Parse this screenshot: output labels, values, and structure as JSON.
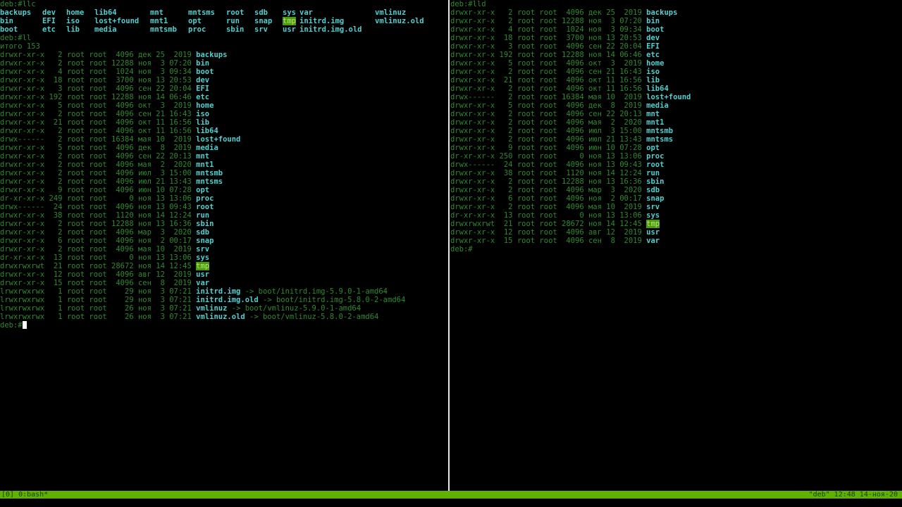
{
  "statusbar": {
    "left": "[0] 0:bash*",
    "right": "\"deb\" 12:48 14-ноя-20"
  },
  "left_pane": {
    "prompt1": "deb:#llc",
    "ls_cols": [
      [
        "backups",
        "bin",
        "boot"
      ],
      [
        "dev",
        "EFI",
        "etc"
      ],
      [
        "home",
        "iso",
        "lib"
      ],
      [
        "lib64",
        "lost+found",
        "media"
      ],
      [
        "mnt",
        "mnt1",
        "mntsmb"
      ],
      [
        "mntsms",
        "opt",
        "proc"
      ],
      [
        "root",
        "run",
        "sbin"
      ],
      [
        "sdb",
        "snap",
        "srv"
      ],
      [
        "sys",
        "tmp",
        "usr"
      ],
      [
        "var",
        "initrd.img",
        "initrd.img.old"
      ],
      [
        "vmlinuz",
        "vmlinuz.old",
        ""
      ]
    ],
    "prompt2": "deb:#ll",
    "total": "итого 153",
    "entries": [
      {
        "meta": "drwxr-xr-x   2 root root  4096 дек 25  2019",
        "name": "backups"
      },
      {
        "meta": "drwxr-xr-x   2 root root 12288 ноя  3 07:20",
        "name": "bin"
      },
      {
        "meta": "drwxr-xr-x   4 root root  1024 ноя  3 09:34",
        "name": "boot"
      },
      {
        "meta": "drwxr-xr-x  18 root root  3700 ноя 13 20:53",
        "name": "dev"
      },
      {
        "meta": "drwxr-xr-x   3 root root  4096 сен 22 20:04",
        "name": "EFI"
      },
      {
        "meta": "drwxr-xr-x 192 root root 12288 ноя 14 06:46",
        "name": "etc"
      },
      {
        "meta": "drwxr-xr-x   5 root root  4096 окт  3  2019",
        "name": "home"
      },
      {
        "meta": "drwxr-xr-x   2 root root  4096 сен 21 16:43",
        "name": "iso"
      },
      {
        "meta": "drwxr-xr-x  21 root root  4096 окт 11 16:56",
        "name": "lib"
      },
      {
        "meta": "drwxr-xr-x   2 root root  4096 окт 11 16:56",
        "name": "lib64"
      },
      {
        "meta": "drwx------   2 root root 16384 мая 10  2019",
        "name": "lost+found"
      },
      {
        "meta": "drwxr-xr-x   5 root root  4096 дек  8  2019",
        "name": "media"
      },
      {
        "meta": "drwxr-xr-x   2 root root  4096 сен 22 20:13",
        "name": "mnt"
      },
      {
        "meta": "drwxr-xr-x   2 root root  4096 мая  2  2020",
        "name": "mnt1"
      },
      {
        "meta": "drwxr-xr-x   2 root root  4096 июл  3 15:00",
        "name": "mntsmb"
      },
      {
        "meta": "drwxr-xr-x   2 root root  4096 июл 21 13:43",
        "name": "mntsms"
      },
      {
        "meta": "drwxr-xr-x   9 root root  4096 июн 10 07:28",
        "name": "opt"
      },
      {
        "meta": "dr-xr-xr-x 249 root root     0 ноя 13 13:06",
        "name": "proc"
      },
      {
        "meta": "drwx------  24 root root  4096 ноя 13 09:43",
        "name": "root"
      },
      {
        "meta": "drwxr-xr-x  38 root root  1120 ноя 14 12:24",
        "name": "run"
      },
      {
        "meta": "drwxr-xr-x   2 root root 12288 ноя 13 16:36",
        "name": "sbin"
      },
      {
        "meta": "drwxr-xr-x   2 root root  4096 мар  3  2020",
        "name": "sdb"
      },
      {
        "meta": "drwxr-xr-x   6 root root  4096 ноя  2 00:17",
        "name": "snap"
      },
      {
        "meta": "drwxr-xr-x   2 root root  4096 мая 10  2019",
        "name": "srv"
      },
      {
        "meta": "dr-xr-xr-x  13 root root     0 ноя 13 13:06",
        "name": "sys"
      },
      {
        "meta": "drwxrwxrwt  21 root root 28672 ноя 14 12:45",
        "name": "tmp",
        "hl": true
      },
      {
        "meta": "drwxr-xr-x  12 root root  4096 авг 12  2019",
        "name": "usr"
      },
      {
        "meta": "drwxr-xr-x  15 root root  4096 сен  8  2019",
        "name": "var"
      },
      {
        "meta": "lrwxrwxrwx   1 root root    29 ноя  3 07:21",
        "name": "initrd.img",
        "target": "-> boot/initrd.img-5.9.0-1-amd64"
      },
      {
        "meta": "lrwxrwxrwx   1 root root    29 ноя  3 07:21",
        "name": "initrd.img.old",
        "target": "-> boot/initrd.img-5.8.0-2-amd64"
      },
      {
        "meta": "lrwxrwxrwx   1 root root    26 ноя  3 07:21",
        "name": "vmlinuz",
        "target": "-> boot/vmlinuz-5.9.0-1-amd64"
      },
      {
        "meta": "lrwxrwxrwx   1 root root    26 ноя  3 07:21",
        "name": "vmlinuz.old",
        "target": "-> boot/vmlinuz-5.8.0-2-amd64"
      }
    ],
    "prompt3": "deb:#"
  },
  "right_pane": {
    "prompt1": "deb:#lld",
    "entries": [
      {
        "meta": "drwxr-xr-x   2 root root  4096 дек 25  2019",
        "name": "backups"
      },
      {
        "meta": "drwxr-xr-x   2 root root 12288 ноя  3 07:20",
        "name": "bin"
      },
      {
        "meta": "drwxr-xr-x   4 root root  1024 ноя  3 09:34",
        "name": "boot"
      },
      {
        "meta": "drwxr-xr-x  18 root root  3700 ноя 13 20:53",
        "name": "dev"
      },
      {
        "meta": "drwxr-xr-x   3 root root  4096 сен 22 20:04",
        "name": "EFI"
      },
      {
        "meta": "drwxr-xr-x 192 root root 12288 ноя 14 06:46",
        "name": "etc"
      },
      {
        "meta": "drwxr-xr-x   5 root root  4096 окт  3  2019",
        "name": "home"
      },
      {
        "meta": "drwxr-xr-x   2 root root  4096 сен 21 16:43",
        "name": "iso"
      },
      {
        "meta": "drwxr-xr-x  21 root root  4096 окт 11 16:56",
        "name": "lib"
      },
      {
        "meta": "drwxr-xr-x   2 root root  4096 окт 11 16:56",
        "name": "lib64"
      },
      {
        "meta": "drwx------   2 root root 16384 мая 10  2019",
        "name": "lost+found"
      },
      {
        "meta": "drwxr-xr-x   5 root root  4096 дек  8  2019",
        "name": "media"
      },
      {
        "meta": "drwxr-xr-x   2 root root  4096 сен 22 20:13",
        "name": "mnt"
      },
      {
        "meta": "drwxr-xr-x   2 root root  4096 мая  2  2020",
        "name": "mnt1"
      },
      {
        "meta": "drwxr-xr-x   2 root root  4096 июл  3 15:00",
        "name": "mntsmb"
      },
      {
        "meta": "drwxr-xr-x   2 root root  4096 июл 21 13:43",
        "name": "mntsms"
      },
      {
        "meta": "drwxr-xr-x   9 root root  4096 июн 10 07:28",
        "name": "opt"
      },
      {
        "meta": "dr-xr-xr-x 250 root root     0 ноя 13 13:06",
        "name": "proc"
      },
      {
        "meta": "drwx------  24 root root  4096 ноя 13 09:43",
        "name": "root"
      },
      {
        "meta": "drwxr-xr-x  38 root root  1120 ноя 14 12:24",
        "name": "run"
      },
      {
        "meta": "drwxr-xr-x   2 root root 12288 ноя 13 16:36",
        "name": "sbin"
      },
      {
        "meta": "drwxr-xr-x   2 root root  4096 мар  3  2020",
        "name": "sdb"
      },
      {
        "meta": "drwxr-xr-x   6 root root  4096 ноя  2 00:17",
        "name": "snap"
      },
      {
        "meta": "drwxr-xr-x   2 root root  4096 мая 10  2019",
        "name": "srv"
      },
      {
        "meta": "dr-xr-xr-x  13 root root     0 ноя 13 13:06",
        "name": "sys"
      },
      {
        "meta": "drwxrwxrwt  21 root root 28672 ноя 14 12:45",
        "name": "tmp",
        "hl": true
      },
      {
        "meta": "drwxr-xr-x  12 root root  4096 авг 12  2019",
        "name": "usr"
      },
      {
        "meta": "drwxr-xr-x  15 root root  4096 сен  8  2019",
        "name": "var"
      }
    ],
    "prompt2": "deb:#"
  },
  "colors": {
    "statusbar": "#5fb300",
    "dir": "#4fd0d0",
    "meta": "#2f8a2f",
    "highlight": "#4a9a12"
  }
}
